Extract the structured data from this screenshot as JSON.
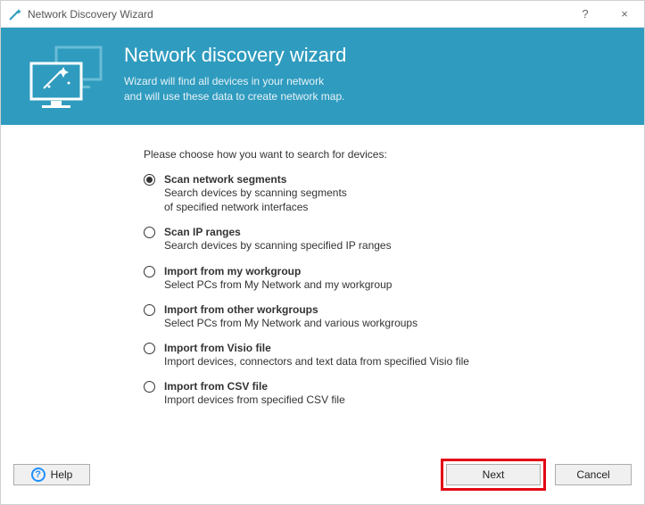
{
  "titlebar": {
    "title": "Network Discovery Wizard",
    "help_tooltip": "?",
    "close_tooltip": "×"
  },
  "banner": {
    "heading": "Network discovery wizard",
    "sub1": "Wizard will find all devices in your network",
    "sub2": "and will use these data to create network map."
  },
  "content": {
    "prompt": "Please choose how you want to search for devices:",
    "options": [
      {
        "title": "Scan network segments",
        "desc": "Search devices by scanning segments\nof specified network interfaces",
        "selected": true
      },
      {
        "title": "Scan IP ranges",
        "desc": "Search devices by scanning specified IP ranges",
        "selected": false
      },
      {
        "title": "Import from my workgroup",
        "desc": "Select PCs from My Network and my workgroup",
        "selected": false
      },
      {
        "title": "Import from other workgroups",
        "desc": "Select PCs from My Network and various workgroups",
        "selected": false
      },
      {
        "title": "Import from Visio file",
        "desc": "Import devices, connectors and text data from specified Visio file",
        "selected": false
      },
      {
        "title": "Import from CSV file",
        "desc": "Import devices from specified CSV file",
        "selected": false
      }
    ]
  },
  "footer": {
    "help": "Help",
    "next": "Next",
    "cancel": "Cancel"
  }
}
